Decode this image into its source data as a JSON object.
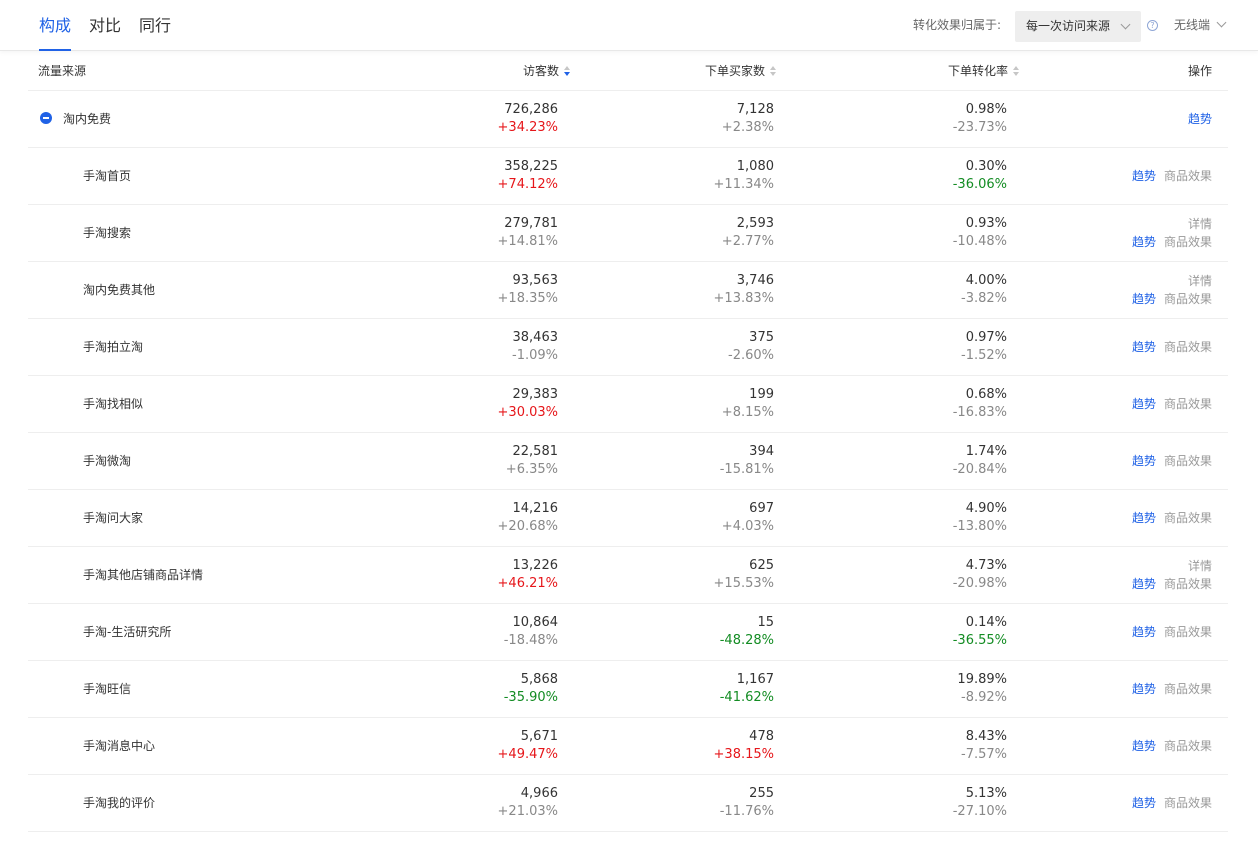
{
  "tabs": [
    {
      "label": "构成",
      "active": true
    },
    {
      "label": "对比",
      "active": false
    },
    {
      "label": "同行",
      "active": false
    }
  ],
  "attribution": {
    "label": "转化效果归属于:",
    "selected": "每一次访问来源"
  },
  "device": {
    "selected": "无线端"
  },
  "table": {
    "headers": {
      "source": "流量来源",
      "visitors": "访客数",
      "buyers": "下单买家数",
      "conversion": "下单转化率",
      "ops": "操作"
    },
    "sort": {
      "column": "visitors",
      "order": "desc"
    },
    "actions": {
      "trend": "趋势",
      "goods": "商品效果",
      "detail": "详情"
    },
    "parent": {
      "name": "淘内免费",
      "visitors": "726,286",
      "visitors_delta": "+34.23%",
      "buyers": "7,128",
      "buyers_delta": "+2.38%",
      "conv": "0.98%",
      "conv_delta": "-23.73%"
    },
    "rows": [
      {
        "name": "手淘首页",
        "visitors": "358,225",
        "visitors_delta": "+74.12%",
        "buyers": "1,080",
        "buyers_delta": "+11.34%",
        "conv": "0.30%",
        "conv_delta": "-36.06%",
        "detail": false
      },
      {
        "name": "手淘搜索",
        "visitors": "279,781",
        "visitors_delta": "+14.81%",
        "buyers": "2,593",
        "buyers_delta": "+2.77%",
        "conv": "0.93%",
        "conv_delta": "-10.48%",
        "detail": true
      },
      {
        "name": "淘内免费其他",
        "visitors": "93,563",
        "visitors_delta": "+18.35%",
        "buyers": "3,746",
        "buyers_delta": "+13.83%",
        "conv": "4.00%",
        "conv_delta": "-3.82%",
        "detail": true
      },
      {
        "name": "手淘拍立淘",
        "visitors": "38,463",
        "visitors_delta": "-1.09%",
        "buyers": "375",
        "buyers_delta": "-2.60%",
        "conv": "0.97%",
        "conv_delta": "-1.52%",
        "detail": false
      },
      {
        "name": "手淘找相似",
        "visitors": "29,383",
        "visitors_delta": "+30.03%",
        "buyers": "199",
        "buyers_delta": "+8.15%",
        "conv": "0.68%",
        "conv_delta": "-16.83%",
        "detail": false
      },
      {
        "name": "手淘微淘",
        "visitors": "22,581",
        "visitors_delta": "+6.35%",
        "buyers": "394",
        "buyers_delta": "-15.81%",
        "conv": "1.74%",
        "conv_delta": "-20.84%",
        "detail": false
      },
      {
        "name": "手淘问大家",
        "visitors": "14,216",
        "visitors_delta": "+20.68%",
        "buyers": "697",
        "buyers_delta": "+4.03%",
        "conv": "4.90%",
        "conv_delta": "-13.80%",
        "detail": false
      },
      {
        "name": "手淘其他店铺商品详情",
        "visitors": "13,226",
        "visitors_delta": "+46.21%",
        "buyers": "625",
        "buyers_delta": "+15.53%",
        "conv": "4.73%",
        "conv_delta": "-20.98%",
        "detail": true
      },
      {
        "name": "手淘-生活研究所",
        "visitors": "10,864",
        "visitors_delta": "-18.48%",
        "buyers": "15",
        "buyers_delta": "-48.28%",
        "conv": "0.14%",
        "conv_delta": "-36.55%",
        "detail": false
      },
      {
        "name": "手淘旺信",
        "visitors": "5,868",
        "visitors_delta": "-35.90%",
        "buyers": "1,167",
        "buyers_delta": "-41.62%",
        "conv": "19.89%",
        "conv_delta": "-8.92%",
        "detail": false
      },
      {
        "name": "手淘消息中心",
        "visitors": "5,671",
        "visitors_delta": "+49.47%",
        "buyers": "478",
        "buyers_delta": "+38.15%",
        "conv": "8.43%",
        "conv_delta": "-7.57%",
        "detail": false
      },
      {
        "name": "手淘我的评价",
        "visitors": "4,966",
        "visitors_delta": "+21.03%",
        "buyers": "255",
        "buyers_delta": "-11.76%",
        "conv": "5.13%",
        "conv_delta": "-27.10%",
        "detail": false
      }
    ]
  },
  "colors": {
    "accent": "#2062e6",
    "increase": "#e6161a",
    "decrease": "#138c23",
    "neutral_delta": "#888888"
  }
}
